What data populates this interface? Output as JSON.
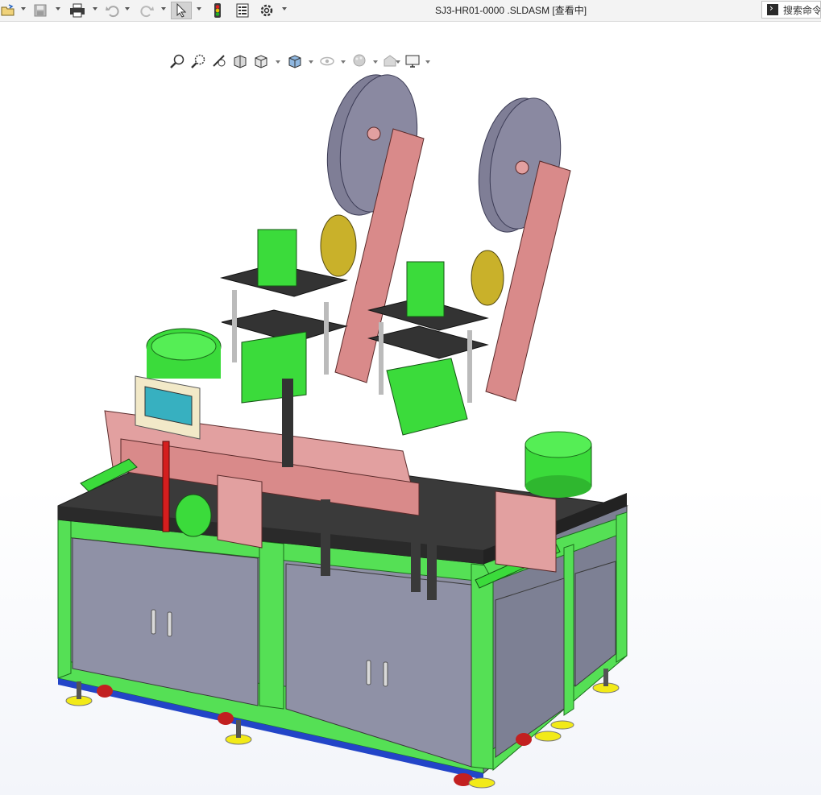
{
  "window": {
    "title": "SJ3-HR01-0000 .SLDASM [查看中]",
    "search_placeholder": "搜索命令"
  },
  "toolbar": {
    "items": [
      {
        "icon": "open-icon",
        "has_dropdown": true
      },
      {
        "icon": "save-icon",
        "has_dropdown": true
      },
      {
        "icon": "print-icon",
        "has_dropdown": true
      },
      {
        "icon": "undo-icon",
        "has_dropdown": true
      },
      {
        "icon": "redo-icon",
        "has_dropdown": true
      },
      {
        "icon": "select-icon",
        "has_dropdown": true,
        "active": true
      },
      {
        "icon": "rebuild-icon"
      },
      {
        "icon": "file-properties-icon"
      },
      {
        "icon": "options-icon",
        "has_dropdown": true
      }
    ]
  },
  "view_toolbar": {
    "items": [
      {
        "icon": "zoom-to-fit-icon"
      },
      {
        "icon": "zoom-to-area-icon"
      },
      {
        "icon": "previous-view-icon"
      },
      {
        "icon": "section-view-icon"
      },
      {
        "icon": "view-orientation-icon",
        "has_dropdown": true
      },
      {
        "icon": "display-style-icon",
        "has_dropdown": true
      },
      {
        "icon": "hide-show-items-icon",
        "has_dropdown": true
      },
      {
        "icon": "edit-appearance-icon",
        "has_dropdown": true
      },
      {
        "icon": "apply-scene-icon",
        "has_dropdown": true
      },
      {
        "icon": "view-settings-icon",
        "has_dropdown": true
      }
    ]
  },
  "viewport": {
    "content": "3D assembly model",
    "colors": {
      "frame_green": "#55e055",
      "panel_gray": "#8d8fa3",
      "top_plate": "#333333",
      "pink_parts": "#e2a0a0",
      "reel_gray": "#7f7e96",
      "wheel_yellow": "#c9b12a",
      "foot_yellow": "#f2ea18",
      "cylinder_green": "#3bdb3b"
    }
  }
}
